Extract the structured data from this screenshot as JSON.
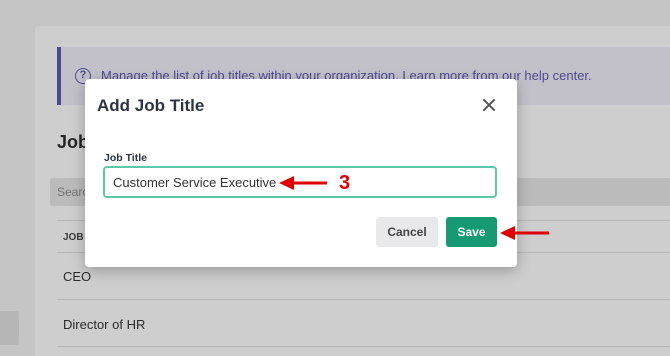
{
  "background": {
    "banner_text": "Manage the list of job titles within your organization. Learn more from our help center.",
    "heading": "Jobs",
    "search_placeholder": "Search",
    "column_header": "JOB",
    "rows": [
      "CEO",
      "Director of HR"
    ]
  },
  "modal": {
    "title": "Add Job Title",
    "field_label": "Job Title",
    "field_value": "Customer Service Executive",
    "cancel_label": "Cancel",
    "save_label": "Save"
  },
  "annotation": {
    "step_number": "3",
    "arrow_color": "#e00000"
  },
  "colors": {
    "primary": "#159a73",
    "input_focus": "#5cc9a8",
    "banner_accent": "#5a55a8"
  }
}
